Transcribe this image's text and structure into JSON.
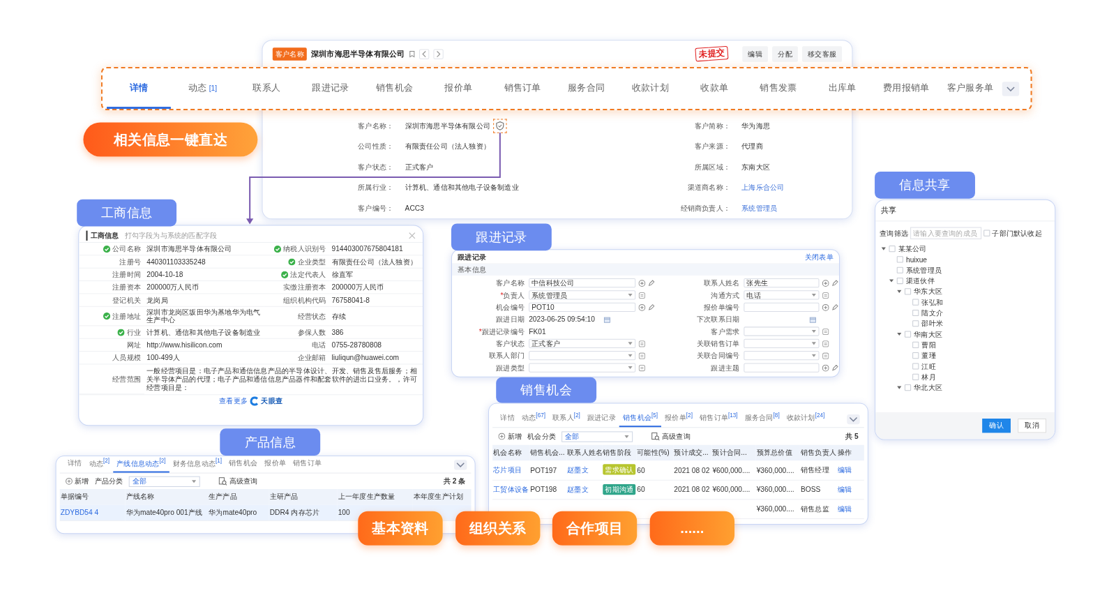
{
  "record_header": {
    "badge": "客户名称",
    "title": "深圳市海思半导体有限公司",
    "stamp": "未提交",
    "buttons": [
      "编辑",
      "分配",
      "移交客服"
    ]
  },
  "main_tabs": [
    {
      "label": "详情",
      "selected": true
    },
    {
      "label": "动态",
      "count": "[1]",
      "selected": false
    },
    {
      "label": "联系人",
      "selected": false
    },
    {
      "label": "跟进记录",
      "selected": false
    },
    {
      "label": "销售机会",
      "selected": false
    },
    {
      "label": "报价单",
      "selected": false
    },
    {
      "label": "销售订单",
      "selected": false
    },
    {
      "label": "服务合同",
      "selected": false
    },
    {
      "label": "收款计划",
      "selected": false
    },
    {
      "label": "收款单",
      "selected": false
    },
    {
      "label": "销售发票",
      "selected": false
    },
    {
      "label": "出库单",
      "selected": false
    },
    {
      "label": "费用报销单",
      "selected": false
    },
    {
      "label": "客户服务单",
      "selected": false
    }
  ],
  "customer_fields": [
    {
      "label": "客户名称：",
      "value": "深圳市海思半导体有限公司",
      "kind": "shielded"
    },
    {
      "label": "客户简称：",
      "value": "华为海思",
      "kind": "text"
    },
    {
      "label": "公司性质：",
      "value": "有限责任公司（法人独资）",
      "kind": "text"
    },
    {
      "label": "客户来源：",
      "value": "代理商",
      "kind": "text"
    },
    {
      "label": "客户状态：",
      "value": "正式客户",
      "kind": "text"
    },
    {
      "label": "所属区域：",
      "value": "东南大区",
      "kind": "text"
    },
    {
      "label": "所属行业：",
      "value": "计算机、通信和其他电子设备制造业",
      "kind": "text"
    },
    {
      "label": "渠道商名称：",
      "value": "上海乐合公司",
      "kind": "link"
    },
    {
      "label": "客户编号：",
      "value": "ACC3",
      "kind": "text"
    },
    {
      "label": "经销商负责人：",
      "value": "系统管理员",
      "kind": "link"
    }
  ],
  "callouts": [
    {
      "text": "相关信息一键直达",
      "kind": "highlight"
    },
    {
      "text": "基本资料",
      "kind": "feature"
    },
    {
      "text": "组织关系",
      "kind": "feature"
    },
    {
      "text": "合作项目",
      "kind": "feature"
    },
    {
      "text": "......",
      "kind": "feature"
    }
  ],
  "business_info": {
    "callout": "工商信息",
    "title": "工商信息",
    "hint": "打勾字段为与系统的匹配字段",
    "fields": [
      {
        "label": "公司名称",
        "value": "深圳市海思半导体有限公司",
        "verified": true
      },
      {
        "label": "纳税人识别号",
        "value": "914403007675804181",
        "verified": true
      },
      {
        "label": "注册号",
        "value": "440301103335248",
        "verified": false
      },
      {
        "label": "企业类型",
        "value": "有限责任公司（法人独资）",
        "verified": true
      },
      {
        "label": "注册时间",
        "value": "2004-10-18",
        "verified": false
      },
      {
        "label": "法定代表人",
        "value": "徐直军",
        "verified": true
      },
      {
        "label": "注册资本",
        "value": "200000万人民币",
        "verified": false
      },
      {
        "label": "实缴注册资本",
        "value": "200000万人民币",
        "verified": false
      },
      {
        "label": "登记机关",
        "value": "龙岗局",
        "verified": false
      },
      {
        "label": "组织机构代码",
        "value": "76758041-8",
        "verified": false
      },
      {
        "label": "注册地址",
        "value": "深圳市龙岗区坂田华为基地华为电气生产中心",
        "verified": true
      },
      {
        "label": "经营状态",
        "value": "存续",
        "verified": false
      },
      {
        "label": "行业",
        "value": "计算机、通信和其他电子设备制造业",
        "verified": true
      },
      {
        "label": "参保人数",
        "value": "386",
        "verified": false
      },
      {
        "label": "网址",
        "value": "http://www.hisilicon.com",
        "verified": false
      },
      {
        "label": "电话",
        "value": "0755-28780808",
        "verified": false
      },
      {
        "label": "人员规模",
        "value": "100-499人",
        "verified": false
      },
      {
        "label": "企业邮箱",
        "value": "liuliqun@huawei.com",
        "verified": false
      }
    ],
    "scope_label": "经营范围",
    "scope": "一般经营项目是：电子产品和通信信息产品的半导体设计、开发、销售及售后服务；相关半导体产品的代理；电子产品和通信信息产品器件和配套软件的进出口业务。，许可经营项目是：",
    "more_link": "查看更多",
    "source": "天眼查"
  },
  "follow_up": {
    "callout": "跟进记录",
    "title": "跟进记录",
    "close_link": "关闭表单",
    "section": "基本信息",
    "fields": [
      {
        "label": "客户名称",
        "value": "中信科技公司",
        "kind": "input"
      },
      {
        "label": "联系人姓名",
        "value": "张先生",
        "kind": "input"
      },
      {
        "label": "负责人",
        "required_mark": "*",
        "value": "系统管理员",
        "kind": "select"
      },
      {
        "label": "沟通方式",
        "value": "电话",
        "kind": "select"
      },
      {
        "label": "机会编号",
        "value": "POT10",
        "kind": "input"
      },
      {
        "label": "报价单编号",
        "kind": "input"
      },
      {
        "label": "跟进日期",
        "value": "2023-06-25 09:54:10",
        "kind": "date"
      },
      {
        "label": "下次联系日期",
        "kind": "date"
      },
      {
        "label": "跟进记录编号",
        "required_mark": "*",
        "value": "FK01",
        "kind": "static"
      },
      {
        "label": "客户需求",
        "kind": "select"
      },
      {
        "label": "客户状态",
        "value": "正式客户",
        "kind": "select"
      },
      {
        "label": "关联销售订单",
        "kind": "select"
      },
      {
        "label": "联系人部门",
        "kind": "select"
      },
      {
        "label": "关联合同编号",
        "kind": "select"
      },
      {
        "label": "跟进类型",
        "kind": "select"
      },
      {
        "label": "跟进主题",
        "kind": "input"
      }
    ]
  },
  "sharing": {
    "callout": "信息共享",
    "title": "共享",
    "filter_label": "查询筛选",
    "filter_placeholder": "请输入要查询的成员",
    "collapse_option": {
      "label": "子部门默认收起",
      "checked": false
    },
    "tree": [
      {
        "label": "某某公司",
        "expanded": true,
        "checked": false,
        "children": [
          {
            "label": "huixue",
            "checked": false
          },
          {
            "label": "系统管理员",
            "checked": false
          },
          {
            "label": "渠道伙伴",
            "expanded": true,
            "checked": false,
            "children": [
              {
                "label": "华东大区",
                "expanded": true,
                "checked": false,
                "children": [
                  {
                    "label": "张弘和",
                    "checked": false
                  },
                  {
                    "label": "陆文介",
                    "checked": false
                  },
                  {
                    "label": "邵叶米",
                    "checked": false
                  }
                ]
              },
              {
                "label": "华南大区",
                "expanded": true,
                "checked": false,
                "children": [
                  {
                    "label": "曹阳",
                    "checked": false
                  },
                  {
                    "label": "董瑾",
                    "checked": false
                  },
                  {
                    "label": "江旺",
                    "checked": false
                  },
                  {
                    "label": "林月",
                    "checked": false
                  }
                ]
              },
              {
                "label": "华北大区",
                "expanded": true,
                "checked": false
              }
            ]
          }
        ]
      }
    ],
    "buttons": [
      {
        "label": "确认",
        "kind": "primary"
      },
      {
        "label": "取消",
        "kind": "default"
      }
    ]
  },
  "sales_opportunities": {
    "callout": "销售机会",
    "tabs": [
      {
        "label": "详情",
        "selected": false
      },
      {
        "label": "动态",
        "count": "[67]",
        "selected": false
      },
      {
        "label": "联系人",
        "count": "[2]",
        "selected": false
      },
      {
        "label": "跟进记录",
        "selected": false
      },
      {
        "label": "销售机会",
        "count": "[5]",
        "selected": true
      },
      {
        "label": "报价单",
        "count": "[2]",
        "selected": false
      },
      {
        "label": "销售订单",
        "count": "[13]",
        "selected": false
      },
      {
        "label": "服务合同",
        "count": "[8]",
        "selected": false
      },
      {
        "label": "收款计划",
        "count": "[24]",
        "selected": false
      }
    ],
    "add_button": "新增",
    "filter_label": "机会分类",
    "filter_value": "全部",
    "advanced_search": "高级查询",
    "total": "共 5",
    "columns": [
      "机会名称",
      "销售机会...",
      "联系人姓名",
      "销售阶段",
      "可能性(%)",
      "预计成交...",
      "预计合同...",
      "预算总价值",
      "销售负责人",
      "操作"
    ],
    "rows": [
      {
        "name": "芯片项目",
        "code": "POT197",
        "contact": "赵墨文",
        "stage": "需求确认",
        "color": "#b7c52e",
        "probability": "60",
        "close_date": "2021 08 02",
        "contract_value": "¥600,000....",
        "budget": "¥360,000....",
        "owner": "销售经理",
        "action": "编辑"
      },
      {
        "name": "工贸体设备",
        "code": "POT198",
        "contact": "赵墨文",
        "stage": "初期沟通",
        "color": "#2fa58a",
        "probability": "60",
        "close_date": "2021 08 02",
        "contract_value": "¥600,000....",
        "budget": "¥360,000....",
        "owner": "BOSS",
        "action": "编辑"
      },
      {
        "budget": "¥360,000....",
        "owner": "销售总监",
        "action": "编辑"
      }
    ]
  },
  "product_info": {
    "callout": "产品信息",
    "tabs": [
      {
        "label": "详情",
        "selected": false
      },
      {
        "label": "动态",
        "count": "[2]",
        "selected": false
      },
      {
        "label": "产线信息动态",
        "count": "[2]",
        "selected": true
      },
      {
        "label": "财务信息动态",
        "count": "[1]",
        "selected": false
      },
      {
        "label": "销售机会",
        "selected": false
      },
      {
        "label": "报价单",
        "selected": false
      },
      {
        "label": "销售订单",
        "selected": false
      }
    ],
    "add_button": "新增",
    "filter_label": "产品分类",
    "filter_value": "全部",
    "advanced_search": "高级查询",
    "total": "共 2 条",
    "columns": [
      "单据编号",
      "产线名称",
      "生产产品",
      "主研产品",
      "上一年度生产数量",
      "本年度生产计划"
    ],
    "rows": [
      {
        "code": "ZDYBD54 4",
        "line": "华为mate40pro 001产线",
        "product": "华为mate40pro",
        "main_product": "DDR4 内存芯片",
        "last_year": "100",
        "selected": true
      }
    ]
  }
}
